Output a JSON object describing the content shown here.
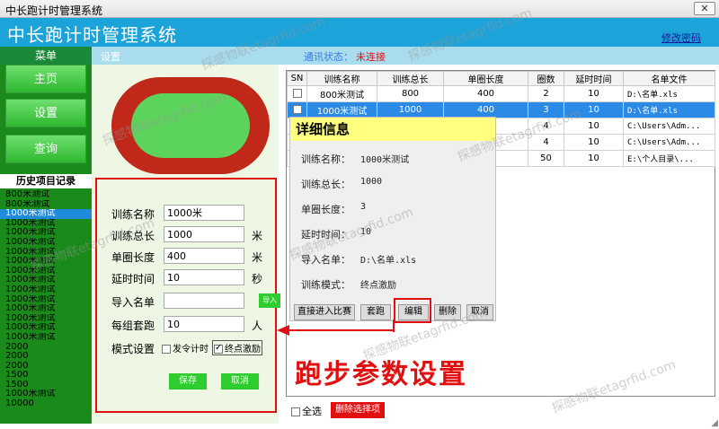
{
  "window": {
    "title": "中长跑计时管理系统",
    "close_glyph": "✕"
  },
  "header": {
    "app_title": "中长跑计时管理系统",
    "change_password": "修改密码"
  },
  "subbar": {
    "menu_tab": "菜单",
    "settings_tab": "设置",
    "status_label": "通讯状态：",
    "status_value": "未连接",
    "status_label_color": "#3b78e0",
    "status_value_color": "#e01010"
  },
  "nav": [
    {
      "label": "主页",
      "icon": ""
    },
    {
      "label": "设置",
      "icon": ""
    },
    {
      "label": "查询",
      "icon": ""
    }
  ],
  "history": {
    "title": "历史项目记录",
    "items": [
      "800米测试",
      "800米测试",
      "1000米测试",
      "1000米测试",
      "1000米测试",
      "1000米测试",
      "1000米测试",
      "1000米测试",
      "1000米测试",
      "1000米测试",
      "1000米测试",
      "1000米测试",
      "1000米测试",
      "1000米测试",
      "1000米测试",
      "1000米测试",
      "2000",
      "2000",
      "2000",
      "1500",
      "1500",
      "1000米测试",
      "10000"
    ],
    "selected_index": 2
  },
  "form": {
    "name_label": "训练名称",
    "name_value": "1000米",
    "total_label": "训练总长",
    "total_value": "1000",
    "total_unit": "米",
    "lap_label": "单圈长度",
    "lap_value": "400",
    "lap_unit": "米",
    "delay_label": "延时时间",
    "delay_value": "10",
    "delay_unit": "秒",
    "import_label": "导入名单",
    "import_value": "",
    "import_button": "导入",
    "group_label": "每组套跑",
    "group_value": "10",
    "group_unit": "人",
    "mode_label": "模式设置",
    "mode_opt1": "发令计时",
    "mode_opt1_checked": false,
    "mode_opt2": "终点激励",
    "mode_opt2_checked": true,
    "save_button": "保存",
    "cancel_button": "取消"
  },
  "table": {
    "headers": [
      "SN",
      "训练名称",
      "训练总长",
      "单圈长度",
      "圈数",
      "延时时间",
      "名单文件"
    ],
    "rows": [
      {
        "name": "800米测试",
        "total": "800",
        "lap": "400",
        "laps": "2",
        "delay": "10",
        "file": "D:\\名单.xls",
        "selected": false
      },
      {
        "name": "1000米测试",
        "total": "1000",
        "lap": "400",
        "laps": "3",
        "delay": "10",
        "file": "D:\\名单.xls",
        "selected": true
      },
      {
        "name": "",
        "total": "",
        "lap": "",
        "laps": "4",
        "delay": "10",
        "file": "C:\\Users\\Adm...",
        "selected": false
      },
      {
        "name": "",
        "total": "",
        "lap": "",
        "laps": "4",
        "delay": "10",
        "file": "C:\\Users\\Adm...",
        "selected": false
      },
      {
        "name": "",
        "total": "",
        "lap": "",
        "laps": "50",
        "delay": "10",
        "file": "E:\\个人目录\\...",
        "selected": false
      }
    ],
    "select_all": "全选",
    "delete_selected": "删除选择项"
  },
  "detail": {
    "title": "详细信息",
    "rows": [
      {
        "label": "训练名称：",
        "value": "1000米测试"
      },
      {
        "label": "训练总长：",
        "value": "1000"
      },
      {
        "label": "单圈长度：",
        "value": "3"
      },
      {
        "label": "延时时间：",
        "value": "10"
      },
      {
        "label": "导入名单：",
        "value": "D:\\名单.xls"
      },
      {
        "label": "训练模式：",
        "value": "终点激励"
      }
    ],
    "buttons": [
      "直接进入比赛",
      "套跑",
      "编辑",
      "删除",
      "取消"
    ]
  },
  "annotation": {
    "label": "跑步参数设置",
    "color": "#e01010"
  },
  "watermark": "探感物联etagrfid.com",
  "colors": {
    "header": "#1ca3d9",
    "sidebar": "#1a8a1a",
    "track_outer": "#c0281a",
    "track_inner": "#5cd45c",
    "selected_row": "#2a8ae6"
  }
}
